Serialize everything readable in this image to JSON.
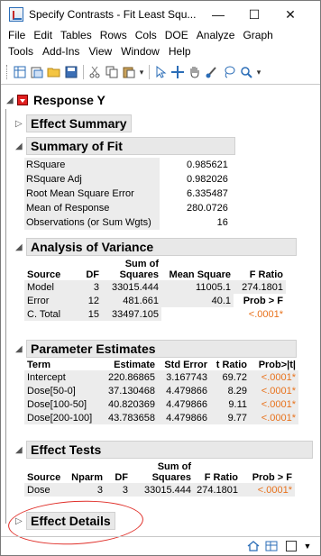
{
  "window": {
    "title": "Specify Contrasts - Fit Least Squ...",
    "controls": {
      "minimize": "—",
      "maximize": "☐",
      "close": "✕"
    }
  },
  "menu": {
    "row1": [
      "File",
      "Edit",
      "Tables",
      "Rows",
      "Cols",
      "DOE",
      "Analyze",
      "Graph"
    ],
    "row2": [
      "Tools",
      "Add-Ins",
      "View",
      "Window",
      "Help"
    ]
  },
  "toolbar": {
    "icons": [
      "new-table-icon",
      "open-icon",
      "folder-icon",
      "save-icon",
      "cut-icon",
      "copy-icon",
      "paste-icon",
      "arrow-tool-icon",
      "crosshair-icon",
      "hand-icon",
      "brush-icon",
      "lasso-icon",
      "magnifier-icon"
    ]
  },
  "report": {
    "title": "Response Y",
    "effect_summary": "Effect Summary",
    "summary_of_fit": {
      "title": "Summary of Fit",
      "rows": [
        {
          "label": "RSquare",
          "value": "0.985621"
        },
        {
          "label": "RSquare Adj",
          "value": "0.982026"
        },
        {
          "label": "Root Mean Square Error",
          "value": "6.335487"
        },
        {
          "label": "Mean of Response",
          "value": "280.0726"
        },
        {
          "label": "Observations (or Sum Wgts)",
          "value": "16"
        }
      ]
    },
    "anova": {
      "title": "Analysis of Variance",
      "headers": {
        "source": "Source",
        "df": "DF",
        "sum_of_squares_1": "Sum of",
        "sum_of_squares_2": "Squares",
        "mean_square": "Mean Square",
        "f_ratio": "F Ratio"
      },
      "rows": [
        {
          "source": "Model",
          "df": "3",
          "ss": "33015.444",
          "ms": "11005.1",
          "f": "274.1801"
        },
        {
          "source": "Error",
          "df": "12",
          "ss": "481.661",
          "ms": "40.1",
          "f": "Prob > F"
        },
        {
          "source": "C. Total",
          "df": "15",
          "ss": "33497.105",
          "ms": "",
          "f": "<.0001*"
        }
      ]
    },
    "parameter_estimates": {
      "title": "Parameter Estimates",
      "headers": {
        "term": "Term",
        "estimate": "Estimate",
        "std_error": "Std Error",
        "t_ratio": "t Ratio",
        "prob": "Prob>|t|"
      },
      "rows": [
        {
          "term": "Intercept",
          "estimate": "220.86865",
          "std_error": "3.167743",
          "t": "69.72",
          "p": "<.0001*"
        },
        {
          "term": "Dose[50-0]",
          "estimate": "37.130468",
          "std_error": "4.479866",
          "t": "8.29",
          "p": "<.0001*"
        },
        {
          "term": "Dose[100-50]",
          "estimate": "40.820369",
          "std_error": "4.479866",
          "t": "9.11",
          "p": "<.0001*"
        },
        {
          "term": "Dose[200-100]",
          "estimate": "43.783658",
          "std_error": "4.479866",
          "t": "9.77",
          "p": "<.0001*"
        }
      ]
    },
    "effect_tests": {
      "title": "Effect Tests",
      "headers": {
        "source": "Source",
        "nparm": "Nparm",
        "df": "DF",
        "ss_1": "Sum of",
        "ss_2": "Squares",
        "f_ratio": "F Ratio",
        "prob": "Prob > F"
      },
      "rows": [
        {
          "source": "Dose",
          "nparm": "3",
          "df": "3",
          "ss": "33015.444",
          "f": "274.1801",
          "p": "<.0001*"
        }
      ]
    },
    "effect_details": "Effect Details"
  },
  "colors": {
    "significant": "#e8721c",
    "red_triangle": "#e02020",
    "annotation_circle": "#e0302a"
  }
}
